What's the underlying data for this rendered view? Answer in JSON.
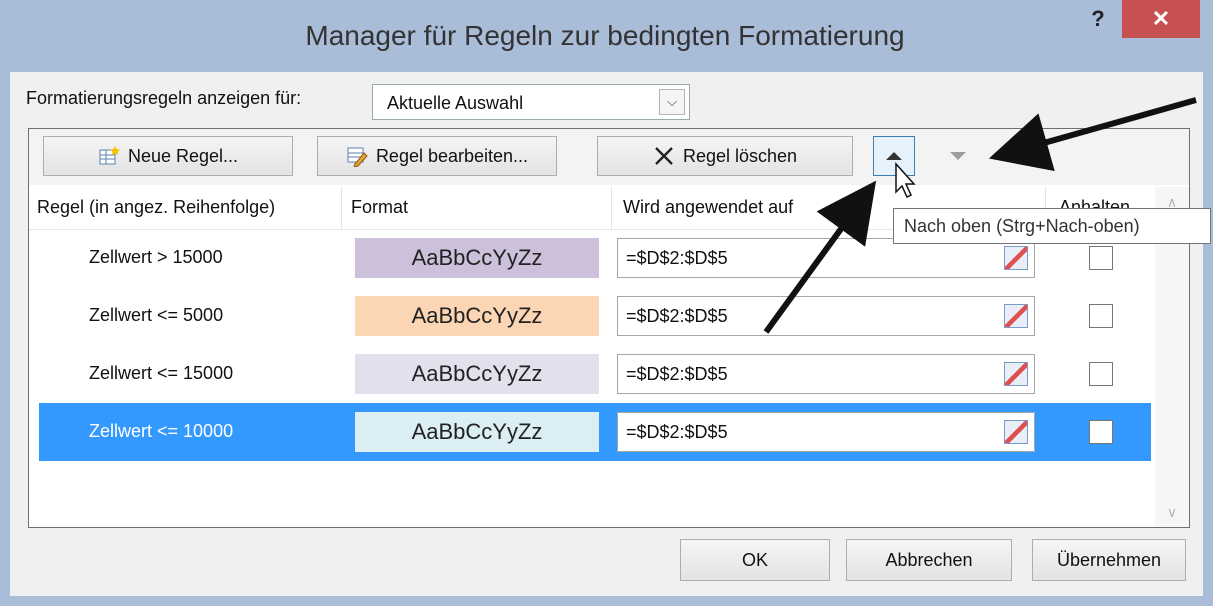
{
  "window": {
    "title": "Manager für Regeln zur bedingten Formatierung",
    "help": "?",
    "close": "✕"
  },
  "scope": {
    "label": "Formatierungsregeln anzeigen für:",
    "value": "Aktuelle Auswahl",
    "dropdown_icon": "⌵"
  },
  "toolbar": {
    "new_rule": "Neue Regel...",
    "edit_rule": "Regel bearbeiten...",
    "delete_rule": "Regel löschen",
    "move_up_icon": "triangle-up-icon",
    "move_down_icon": "triangle-down-icon"
  },
  "columns": {
    "rule": "Regel (in angez. Reihenfolge)",
    "format": "Format",
    "applies_to": "Wird angewendet auf",
    "stop": "Anhalten"
  },
  "rules": [
    {
      "rule": "Zellwert > 15000",
      "preview": "AaBbCcYyZz",
      "preview_color": "#ccc0da",
      "range": "=$D$2:$D$5",
      "stop_if_true": false,
      "selected": false
    },
    {
      "rule": "Zellwert <= 5000",
      "preview": "AaBbCcYyZz",
      "preview_color": "#fcd5b4",
      "range": "=$D$2:$D$5",
      "stop_if_true": false,
      "selected": false
    },
    {
      "rule": "Zellwert <= 15000",
      "preview": "AaBbCcYyZz",
      "preview_color": "#e4dfec",
      "range": "=$D$2:$D$5",
      "stop_if_true": false,
      "selected": false
    },
    {
      "rule": "Zellwert <= 10000",
      "preview": "AaBbCcYyZz",
      "preview_color": "#daeef3",
      "range": "=$D$2:$D$5",
      "stop_if_true": false,
      "selected": true
    }
  ],
  "tooltip": "Nach oben (Strg+Nach-oben)",
  "footer": {
    "ok": "OK",
    "cancel": "Abbrechen",
    "apply": "Übernehmen"
  },
  "colors": {
    "selection": "#3399ff",
    "close": "#c75050",
    "frame": "#a9bcd8"
  }
}
